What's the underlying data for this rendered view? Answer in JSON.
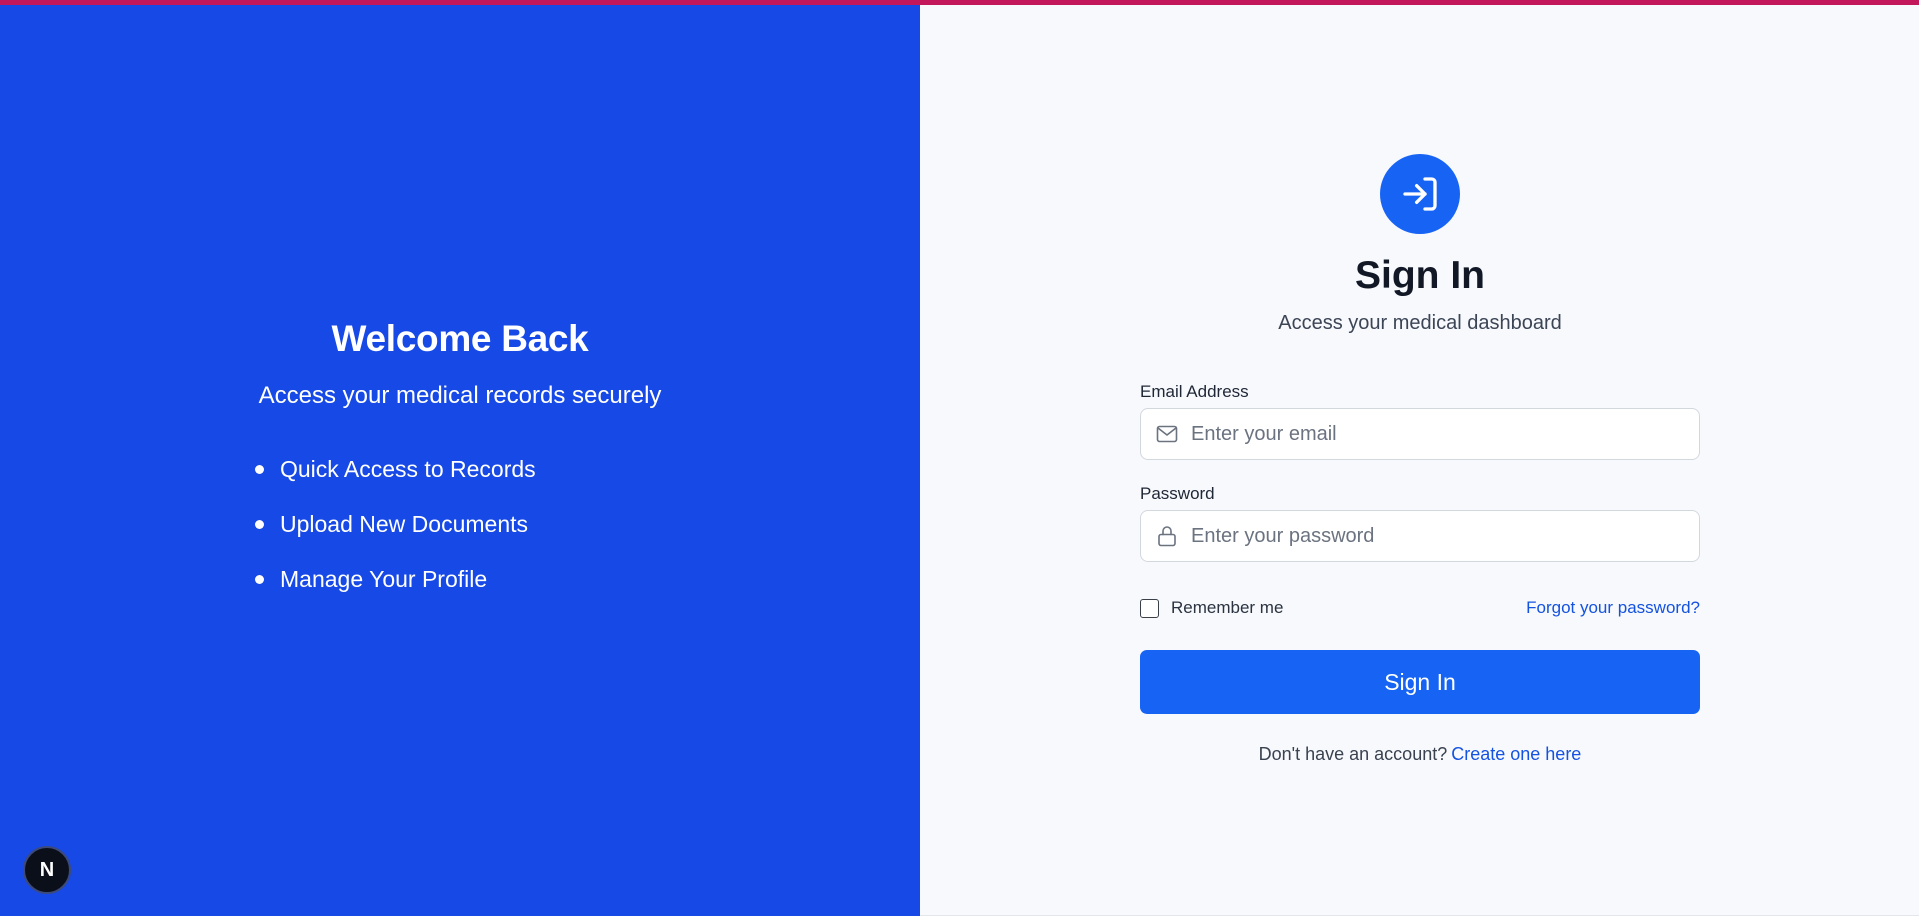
{
  "colors": {
    "left_panel": "#1649e6",
    "accent": "#1764f4",
    "link": "#1452e0",
    "top_bar": "#c2185b"
  },
  "left": {
    "title": "Welcome Back",
    "subtitle": "Access your medical records securely",
    "features": [
      {
        "label": "Quick Access to Records"
      },
      {
        "label": "Upload New Documents"
      },
      {
        "label": "Manage Your Profile"
      }
    ],
    "badge": "N"
  },
  "signin": {
    "icon": "login-arrow-icon",
    "title": "Sign In",
    "subtitle": "Access your medical dashboard",
    "email": {
      "label": "Email Address",
      "placeholder": "Enter your email",
      "value": "",
      "icon": "mail-icon"
    },
    "password": {
      "label": "Password",
      "placeholder": "Enter your password",
      "value": "",
      "icon": "lock-icon"
    },
    "remember_label": "Remember me",
    "remember_checked": false,
    "forgot_label": "Forgot your password?",
    "submit_label": "Sign In",
    "signup_prompt": "Don't have an account?",
    "signup_link": "Create one here"
  }
}
